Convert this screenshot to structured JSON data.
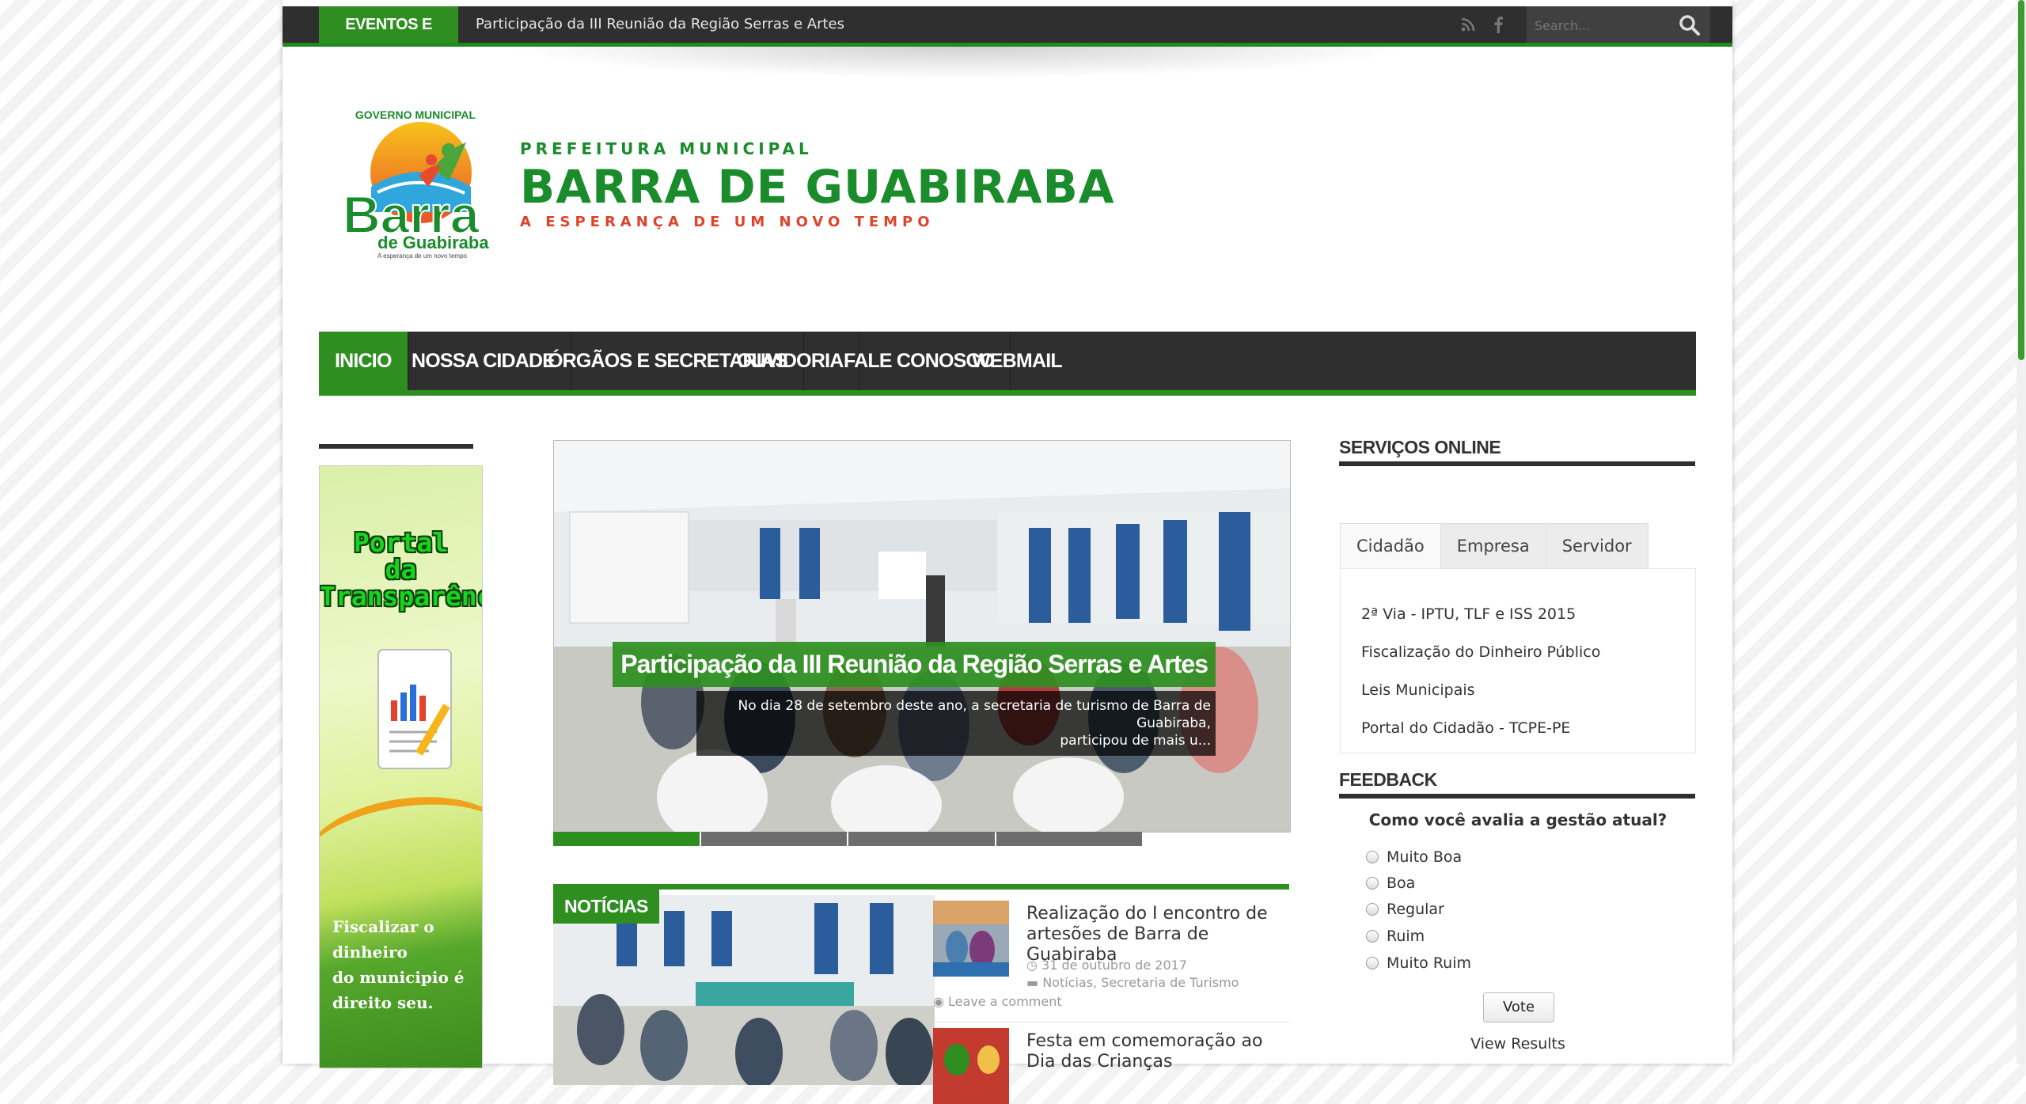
{
  "topbar": {
    "label": "EVENTOS E NOTÍCIAS",
    "ticker": "Participação da III Reunião da Região Serras e Artes",
    "icons": [
      "rss-icon",
      "facebook-icon"
    ],
    "search_placeholder": "Search..."
  },
  "brand": {
    "logo_word": "Barra",
    "logo_sub": "de Guabiraba",
    "logo_arc": "GOVERNO MUNICIPAL",
    "logo_tag": "A esperança de um novo tempo",
    "pre": "PREFEITURA MUNICIPAL",
    "name": "BARRA DE GUABIRABA",
    "slogan": "A ESPERANÇA DE UM NOVO TEMPO"
  },
  "nav": {
    "items": [
      {
        "label": "INICIO",
        "active": true
      },
      {
        "label": "NOSSA CIDADE",
        "active": false
      },
      {
        "label": "ÓRGÃOS E SECRETARIAS",
        "active": false
      },
      {
        "label": "OUVIDORIA",
        "active": false
      },
      {
        "label": "FALE CONOSCO",
        "active": false
      },
      {
        "label": "WEBMAIL",
        "active": false
      }
    ]
  },
  "banner": {
    "title_lines": [
      "Portal",
      "da",
      "Transparência"
    ],
    "text_lines": [
      "Fiscalizar o",
      "dinheiro",
      "do municipio é",
      "direito seu."
    ]
  },
  "slider": {
    "title": "Participação da III Reunião da Região Serras e Artes",
    "desc_line1": "No dia 28 de setembro deste ano, a secretaria de turismo de Barra de Guabiraba,",
    "desc_line2": "participou de mais u...",
    "active_slide": 1,
    "slide_count": 4
  },
  "noticias": {
    "label": "NOTÍCIAS",
    "posts": [
      {
        "title": "Realização do I encontro de artesões de Barra de Guabiraba",
        "date": "31 de outubro de 2017",
        "categories": "Notícias, Secretaria de Turismo",
        "comments": "Leave a comment"
      },
      {
        "title": "Festa em comemoração ao Dia das Crianças"
      }
    ]
  },
  "sidebar": {
    "services_title": "SERVIÇOS ONLINE",
    "tabs": [
      "Cidadão",
      "Empresa",
      "Servidor"
    ],
    "links": [
      "2ª Via - IPTU, TLF e ISS 2015",
      "Fiscalização do Dinheiro Público",
      "Leis Municipais",
      "Portal do Cidadão - TCPE-PE"
    ],
    "feedback_title": "FEEDBACK",
    "poll_question": "Como você avalia a gestão atual?",
    "poll_options": [
      "Muito Boa",
      "Boa",
      "Regular",
      "Ruim",
      "Muito Ruim"
    ],
    "vote_label": "Vote",
    "view_results": "View Results"
  },
  "colors": {
    "accent": "#2e8f20",
    "dark": "#2f2f2f",
    "brand_green": "#1a8c2c",
    "brand_red": "#e0432a"
  }
}
